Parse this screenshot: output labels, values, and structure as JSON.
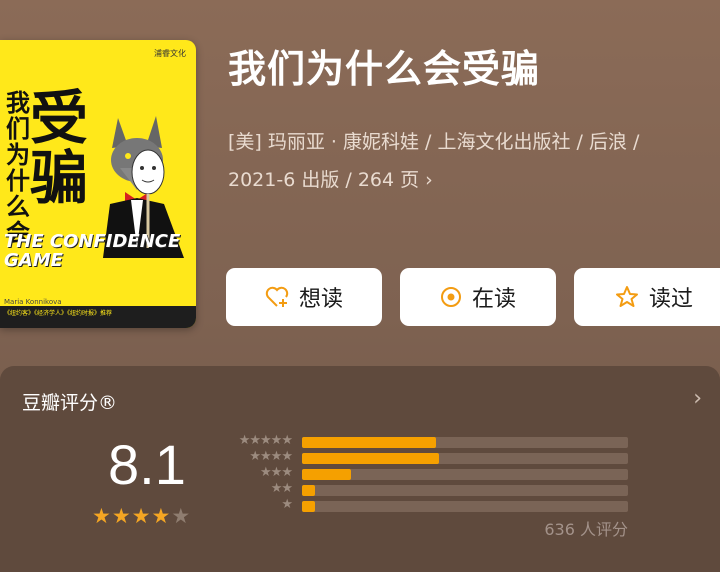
{
  "cover": {
    "publisher_mark": "浦睿文化",
    "title_small": "我们为什么会",
    "title_big": "受骗",
    "title_en": "THE CONFIDENCE GAME",
    "author_en": "Maria Konnikova",
    "band_text": "《纽约客》《经济学人》《纽约时报》推荐"
  },
  "book": {
    "title": "我们为什么会受骗",
    "meta_line1": "[美] 玛丽亚 · 康妮科娃 / 上海文化出版社 / 后浪 /",
    "meta_line2": "2021-6 出版 / 264 页"
  },
  "actions": [
    {
      "label": "想读",
      "icon": "heart-plus-icon"
    },
    {
      "label": "在读",
      "icon": "target-icon"
    },
    {
      "label": "读过",
      "icon": "star-outline-icon"
    }
  ],
  "rating": {
    "section_title": "豆瓣评分®",
    "score": "8.1",
    "stars_filled": 4,
    "stars_total": 5,
    "count_text": "636 人评分",
    "distribution": [
      {
        "stars": 5,
        "value": 0.41
      },
      {
        "stars": 4,
        "value": 0.42
      },
      {
        "stars": 3,
        "value": 0.15
      },
      {
        "stars": 2,
        "value": 0.04
      },
      {
        "stars": 1,
        "value": 0.04
      }
    ]
  },
  "colors": {
    "accent": "#f5a000",
    "background": "#8b6b57",
    "panel": "#5f4a3d"
  }
}
